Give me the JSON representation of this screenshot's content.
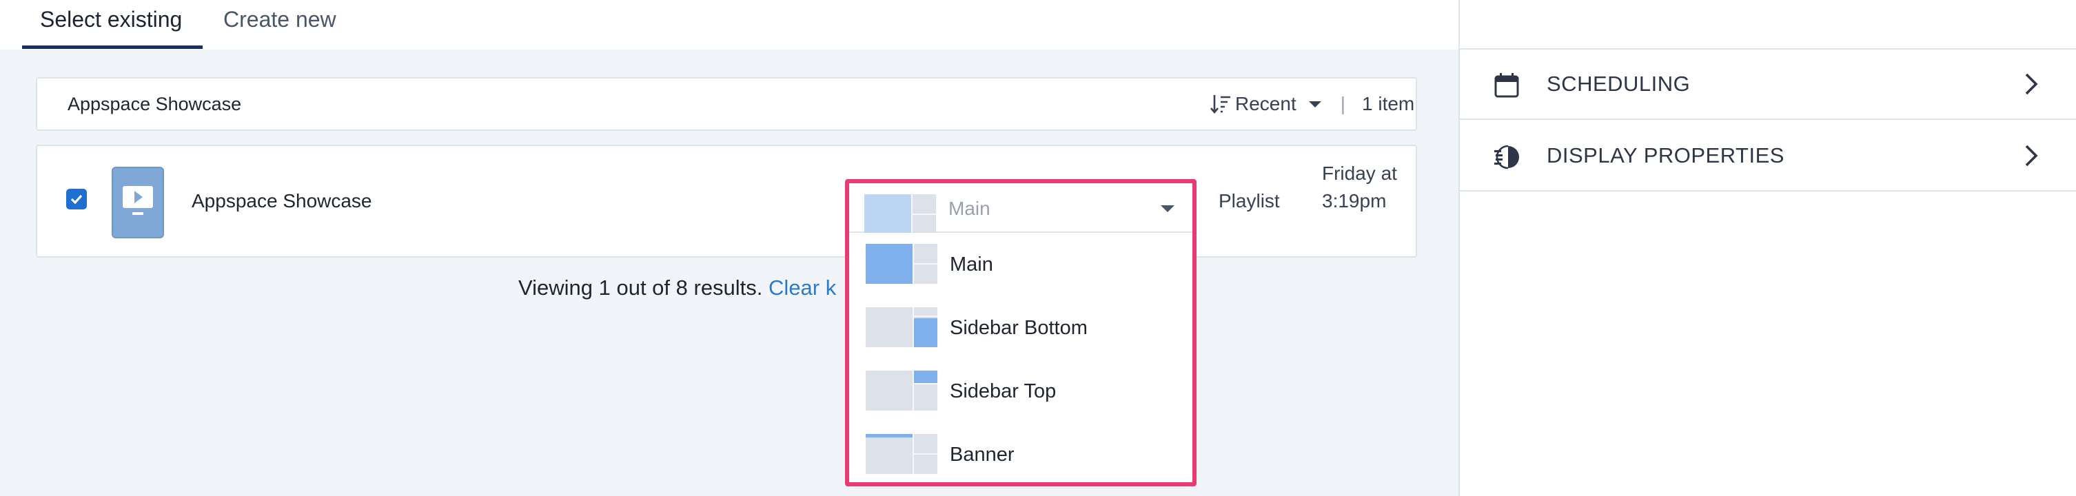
{
  "tabs": [
    {
      "label": "Select existing",
      "active": true
    },
    {
      "label": "Create new",
      "active": false
    }
  ],
  "header": {
    "title": "Appspace Showcase",
    "sort_label": "Recent",
    "separator": "|",
    "count": "1 item"
  },
  "row": {
    "checked": true,
    "title": "Appspace Showcase",
    "zone_selected": "Main",
    "type": "Playlist",
    "modified": "Friday at 3:19pm"
  },
  "results": {
    "text": "Viewing 1 out of 8 results.",
    "link": "Clear k"
  },
  "zone_options": [
    {
      "label": "Main"
    },
    {
      "label": "Sidebar Bottom"
    },
    {
      "label": "Sidebar Top"
    },
    {
      "label": "Banner"
    }
  ],
  "right_sections": [
    {
      "title": "SCHEDULING",
      "icon": "calendar-icon"
    },
    {
      "title": "DISPLAY PROPERTIES",
      "icon": "display-properties-icon"
    }
  ],
  "colors": {
    "accent": "#1f6fd1",
    "highlight_border": "#e83b72",
    "link": "#2b7bc8",
    "zone_fill": "#7fb0ec",
    "tab_underline": "#1d2d5c"
  }
}
